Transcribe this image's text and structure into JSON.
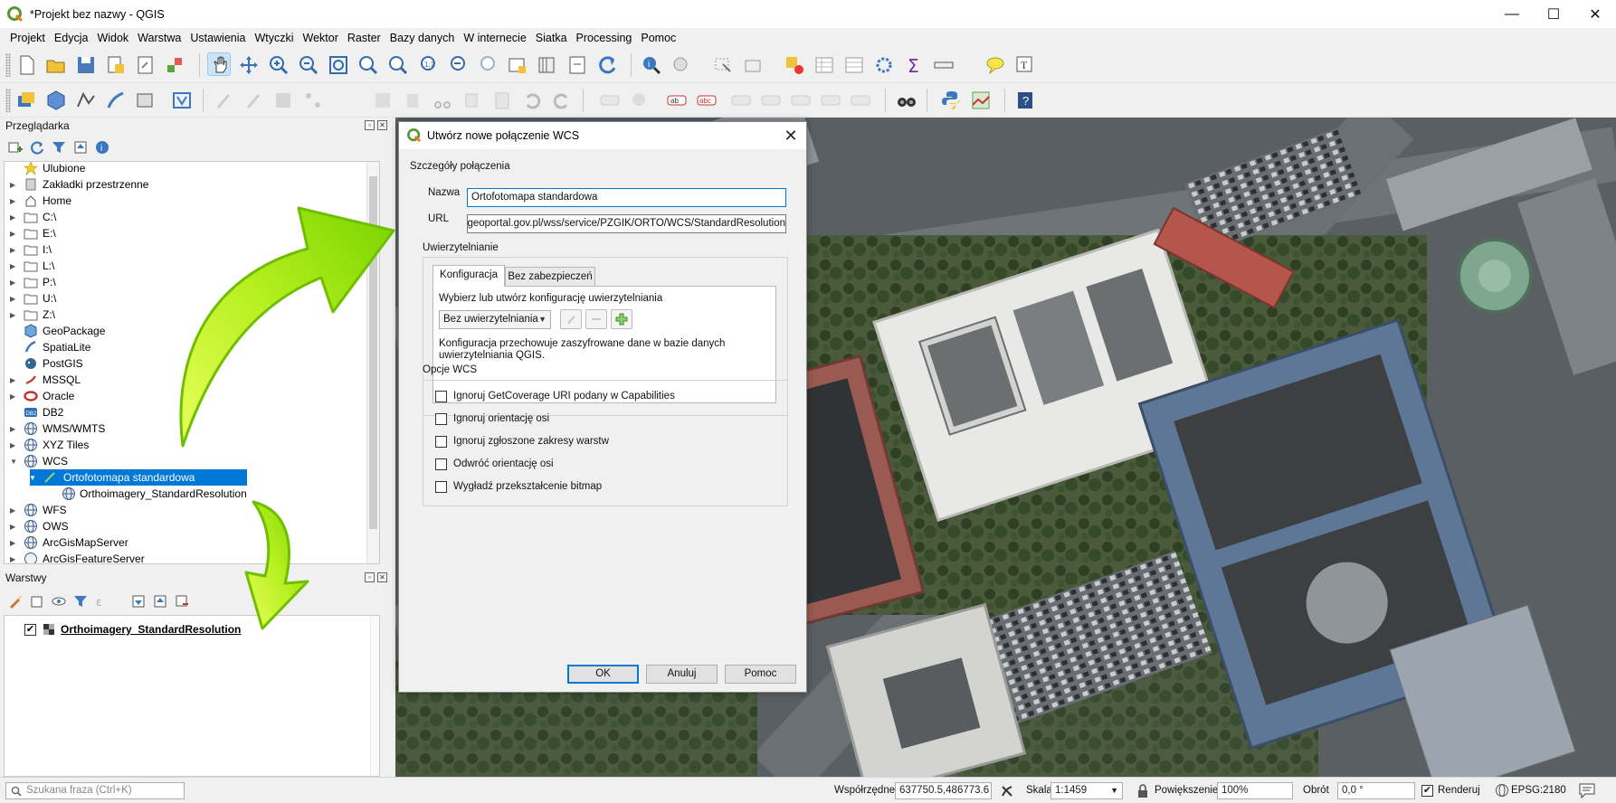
{
  "window": {
    "title": "*Projekt bez nazwy - QGIS",
    "minimize": "—",
    "maximize": "☐",
    "close": "✕"
  },
  "menu": [
    "Projekt",
    "Edycja",
    "Widok",
    "Warstwa",
    "Ustawienia",
    "Wtyczki",
    "Wektor",
    "Raster",
    "Bazy danych",
    "W internecie",
    "Siatka",
    "Processing",
    "Pomoc"
  ],
  "browser": {
    "title": "Przeglądarka",
    "items": [
      {
        "label": "Ulubione",
        "icon": "star-icon"
      },
      {
        "label": "Zakładki przestrzenne",
        "icon": "bookmark-icon"
      },
      {
        "label": "Home",
        "icon": "home-icon"
      },
      {
        "label": "C:\\",
        "icon": "folder-icon"
      },
      {
        "label": "E:\\",
        "icon": "folder-icon"
      },
      {
        "label": "I:\\",
        "icon": "folder-icon"
      },
      {
        "label": "L:\\",
        "icon": "folder-icon"
      },
      {
        "label": "P:\\",
        "icon": "folder-icon"
      },
      {
        "label": "U:\\",
        "icon": "folder-icon"
      },
      {
        "label": "Z:\\",
        "icon": "folder-icon"
      },
      {
        "label": "GeoPackage",
        "icon": "geopackage-icon"
      },
      {
        "label": "SpatiaLite",
        "icon": "spatialite-icon"
      },
      {
        "label": "PostGIS",
        "icon": "postgis-icon"
      },
      {
        "label": "MSSQL",
        "icon": "mssql-icon"
      },
      {
        "label": "Oracle",
        "icon": "oracle-icon"
      },
      {
        "label": "DB2",
        "icon": "db2-icon"
      },
      {
        "label": "WMS/WMTS",
        "icon": "globe-icon"
      },
      {
        "label": "XYZ Tiles",
        "icon": "globe-icon"
      },
      {
        "label": "WCS",
        "icon": "globe-icon"
      },
      {
        "label": "Ortofotomapa standardowa",
        "icon": "connection-icon"
      },
      {
        "label": "Orthoimagery_StandardResolution",
        "icon": "coverage-icon"
      },
      {
        "label": "WFS",
        "icon": "globe-icon"
      },
      {
        "label": "OWS",
        "icon": "globe-icon"
      },
      {
        "label": "ArcGisMapServer",
        "icon": "globe-icon"
      },
      {
        "label": "ArcGisFeatureServer",
        "icon": "globe-icon"
      }
    ]
  },
  "layers": {
    "title": "Warstwy",
    "items": [
      {
        "label": "Orthoimagery_StandardResolution",
        "checked": true
      }
    ]
  },
  "dialog": {
    "title": "Utwórz nowe połączenie WCS",
    "details_heading": "Szczegóły połączenia",
    "name_label": "Nazwa",
    "name_value": "Ortofotomapa standardowa",
    "url_label": "URL",
    "url_value": "://mapy.geoportal.gov.pl/wss/service/PZGIK/ORTO/WCS/StandardResolution",
    "auth_heading": "Uwierzytelnianie",
    "tabs": [
      "Konfiguracja",
      "Bez zabezpieczeń"
    ],
    "auth_prompt": "Wybierz lub utwórz konfigurację uwierzytelniania",
    "auth_combo": "Bez uwierzytelniania",
    "auth_note_1": "Konfiguracja przechowuje zaszyfrowane dane w bazie danych",
    "auth_note_2": "uwierzytelniania QGIS.",
    "wcs_options_heading": "Opcje WCS",
    "options": [
      "Ignoruj GetCoverage URI podany w Capabilities",
      "Ignoruj orientację osi",
      "Ignoruj zgłoszone zakresy warstw",
      "Odwróć orientację osi",
      "Wygładź przekształcenie bitmap"
    ],
    "ok": "OK",
    "cancel": "Anuluj",
    "help": "Pomoc"
  },
  "statusbar": {
    "search_placeholder": "Szukana fraza (Ctrl+K)",
    "coord_label": "Współrzędne",
    "coord_value": "637750.5,486773.6",
    "scale_label": "Skala",
    "scale_value": "1:1459",
    "magnifier_label": "Powiększenie",
    "magnifier_value": "100%",
    "rotation_label": "Obrót",
    "rotation_value": "0,0 °",
    "render_label": "Renderuj",
    "crs": "EPSG:2180"
  },
  "colors": {
    "selection": "#0078d7",
    "highlight_box": "#2b35b5",
    "arrow_green": "#8ee000"
  }
}
